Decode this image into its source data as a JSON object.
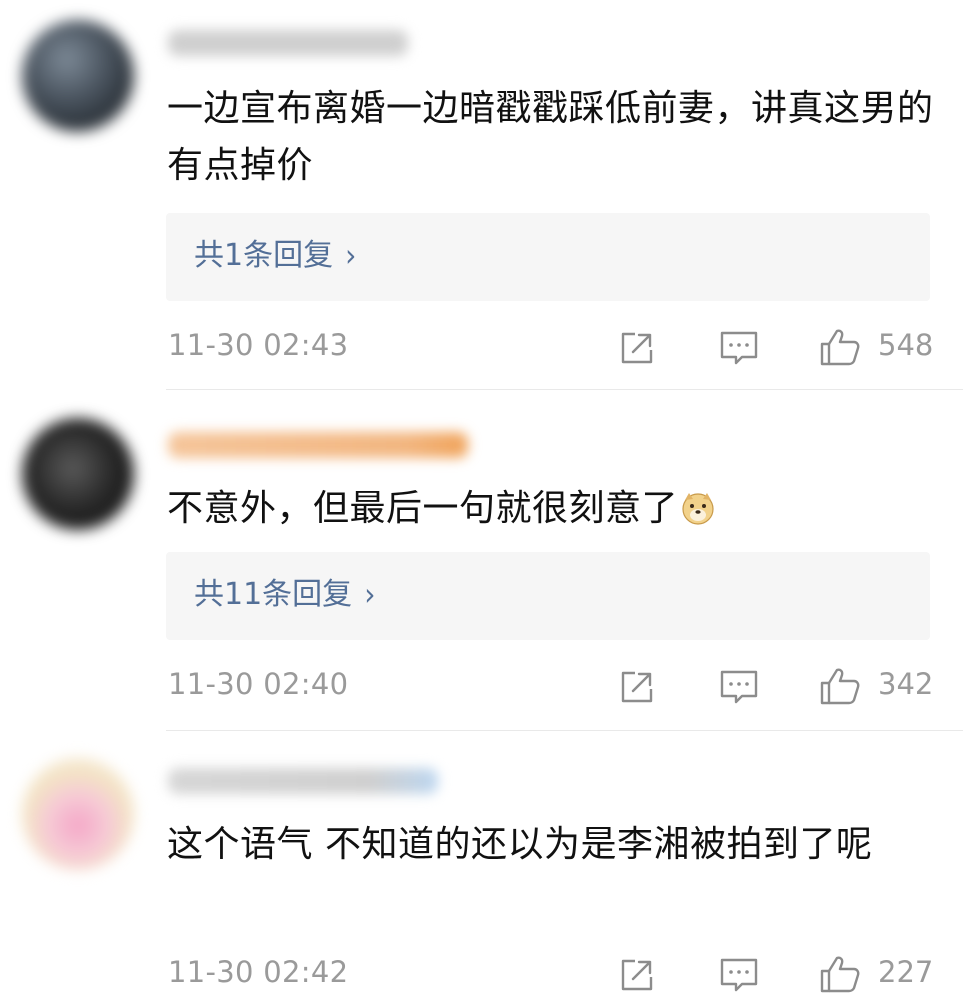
{
  "comments": [
    {
      "text": "一边宣布离婚一边暗戳戳踩低前妻，讲真这男的有点掉价",
      "reply_link": "共1条回复",
      "time": "11-30 02:43",
      "likes": "548",
      "emoji": ""
    },
    {
      "text": "不意外，但最后一句就很刻意了",
      "reply_link": "共11条回复",
      "time": "11-30 02:40",
      "likes": "342",
      "emoji": "doge-emoji"
    },
    {
      "text": "这个语气 不知道的还以为是李湘被拍到了呢",
      "reply_link": "",
      "time": "11-30 02:42",
      "likes": "227",
      "emoji": ""
    }
  ],
  "icons": {
    "share": "share-icon",
    "comment": "comment-icon",
    "like": "like-icon",
    "reply_chevron": "chevron-right-icon"
  },
  "colors": {
    "reply_link": "#536f97",
    "meta_text": "#9a9a9a",
    "reply_box": "#f6f6f6",
    "text": "#111111"
  }
}
